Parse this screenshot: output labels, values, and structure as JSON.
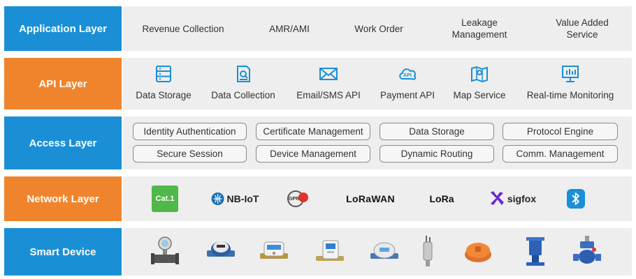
{
  "layers": {
    "application": {
      "label": "Application Layer",
      "items": [
        "Revenue Collection",
        "AMR/AMI",
        "Work Order",
        "Leakage\nManagement",
        "Value Added\nService"
      ]
    },
    "api": {
      "label": "API Layer",
      "items": [
        {
          "label": "Data Storage",
          "icon": "database-icon"
        },
        {
          "label": "Data Collection",
          "icon": "document-search-icon"
        },
        {
          "label": "Email/SMS API",
          "icon": "envelope-icon"
        },
        {
          "label": "Payment API",
          "icon": "api-cloud-icon"
        },
        {
          "label": "Map Service",
          "icon": "map-pin-icon"
        },
        {
          "label": "Real-time Monitoring",
          "icon": "monitor-chart-icon"
        }
      ]
    },
    "access": {
      "label": "Access Layer",
      "row1": [
        "Identity Authentication",
        "Certificate Management",
        "Data Storage",
        "Protocol Engine"
      ],
      "row2": [
        "Secure Session",
        "Device Management",
        "Dynamic Routing",
        "Comm. Management"
      ]
    },
    "network": {
      "label": "Network Layer",
      "logos": {
        "cat1": "Cat.1",
        "nbiot": "NB-IoT",
        "gprs": "GPRS",
        "lorawan": "LoRaWAN",
        "lora": "LoRa",
        "sigfox": "sigfox",
        "bluetooth": "bluetooth-icon"
      }
    },
    "device": {
      "label": "Smart Device",
      "devices": [
        "electromagnetic-flow-meter",
        "water-meter",
        "prepaid-water-meter",
        "smart-water-meter",
        "ultrasonic-water-meter",
        "pressure-sensor",
        "leak-detector",
        "hydrant-valve",
        "control-valve"
      ]
    }
  },
  "colors": {
    "blue": "#1a8fd6",
    "orange": "#f0842c",
    "panel": "#eeeeee"
  }
}
